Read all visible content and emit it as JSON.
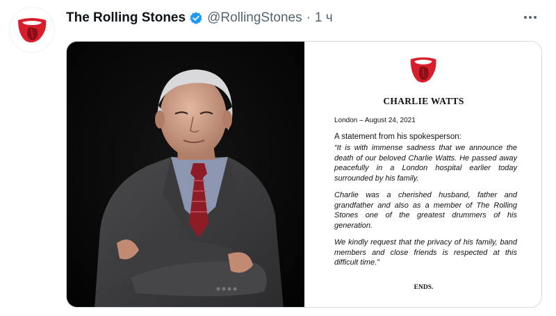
{
  "tweet": {
    "display_name": "The Rolling Stones",
    "handle": "@RollingStones",
    "separator": "·",
    "time": "1 ч",
    "avatar_icon": "rolling-stones-tongue-logo",
    "verified_icon": "verified-badge-icon",
    "more_icon": "more-horizontal-icon",
    "accent_color": "#1d9bf0"
  },
  "media": {
    "photo_icon": "charlie-watts-portrait",
    "statement": {
      "logo_icon": "rolling-stones-tongue-logo",
      "title": "CHARLIE WATTS",
      "date": "London – August 24, 2021",
      "lead": "A statement from his spokesperson:",
      "paragraphs": [
        "“It is with immense sadness that we announce the death of our beloved Charlie Watts. He passed away peacefully in a London hospital earlier today surrounded by his family.",
        "Charlie was a cherished husband, father and grandfather and also as a member of The Rolling Stones one of the greatest drummers of his generation.",
        "We kindly request that the privacy of his family, band members and close friends is respected at this difficult time.”"
      ],
      "ends": "ENDS."
    }
  }
}
